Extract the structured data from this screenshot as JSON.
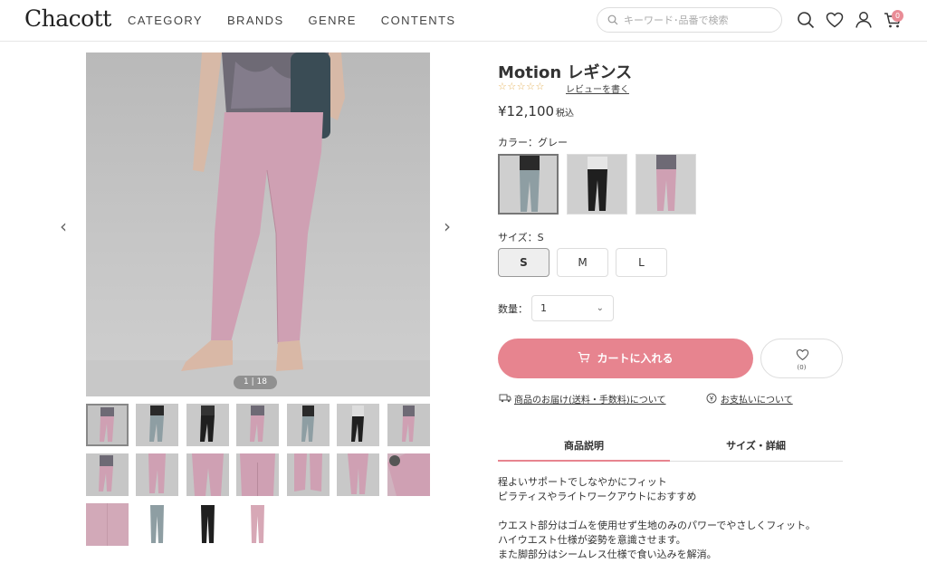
{
  "header": {
    "logo": "Chacott",
    "nav": [
      "CATEGORY",
      "BRANDS",
      "GENRE",
      "CONTENTS"
    ],
    "search_placeholder": "キーワード･品番で検索",
    "cart_count": "0",
    "icons": [
      "search-icon",
      "heart-icon",
      "user-icon",
      "cart-icon"
    ]
  },
  "gallery": {
    "counter": "1 | 18",
    "prev": "‹",
    "next": "›"
  },
  "product": {
    "title": "Motion レギンス",
    "stars": "☆☆☆☆☆",
    "review_link": "レビューを書く",
    "price": "¥12,100",
    "tax_label": "税込",
    "color_label": "カラー：グレー",
    "size_label": "サイズ：S",
    "sizes": [
      "S",
      "M",
      "L"
    ],
    "qty_label": "数量：",
    "qty_value": "1",
    "cart_button": "カートに入れる",
    "fav_count": "(0)",
    "delivery_link": "商品のお届け(送料・手数料)について",
    "payment_link": "お支払いについて",
    "tabs": [
      "商品説明",
      "サイズ・詳細"
    ],
    "desc": [
      "程よいサポートでしなやかにフィット",
      "ピラティスやライトワークアウトにおすすめ",
      "ウエスト部分はゴムを使用せず生地のみのパワーでやさしくフィット。",
      "ハイウエスト仕様が姿勢を意識させます。",
      "また脚部分はシームレス仕様で食い込みを解消。"
    ]
  },
  "colors": {
    "accent": "#e7848f",
    "legging_pink": "#cfa0b3",
    "legging_grey": "#8e9ea3",
    "legging_black": "#1f1f1f"
  }
}
